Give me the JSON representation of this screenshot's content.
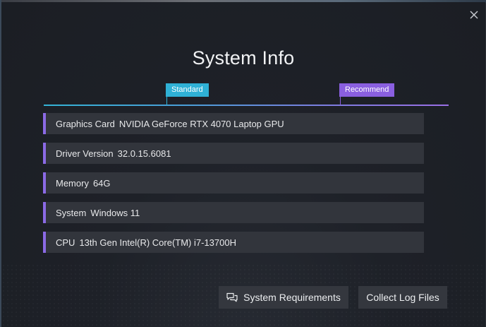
{
  "dialog": {
    "title": "System Info",
    "close_icon": "close-icon"
  },
  "scale": {
    "standard_label": "Standard",
    "recommend_label": "Recommend",
    "colors": {
      "standard": "#2fb1d6",
      "recommend": "#8a5fe0"
    }
  },
  "info_rows": [
    {
      "key": "Graphics Card",
      "value": "NVIDIA GeForce RTX 4070 Laptop GPU"
    },
    {
      "key": "Driver Version",
      "value": "32.0.15.6081"
    },
    {
      "key": "Memory",
      "value": "64G"
    },
    {
      "key": "System",
      "value": "Windows 11"
    },
    {
      "key": "CPU",
      "value": "13th Gen Intel(R) Core(TM) i7-13700H"
    }
  ],
  "buttons": {
    "system_requirements": {
      "label": "System Requirements",
      "icon": "chat-bubbles-icon"
    },
    "collect_logs": {
      "label": "Collect Log Files"
    }
  }
}
